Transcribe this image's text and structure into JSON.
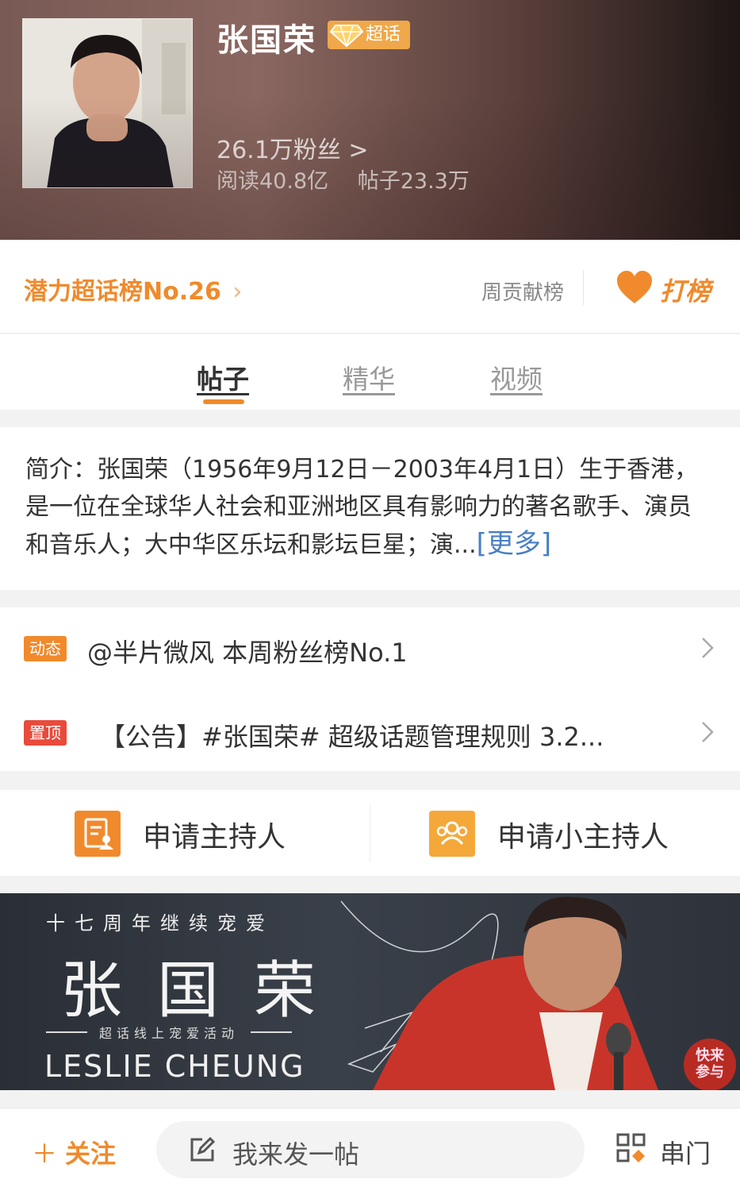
{
  "header": {
    "name": "张国荣",
    "badge": "超话",
    "fans": "26.1万粉丝 >",
    "reads": "阅读40.8亿",
    "posts": "帖子23.3万"
  },
  "rank": {
    "label": "潜力超话榜No.26",
    "contrib_label": "周贡献榜",
    "vote_label": "打榜"
  },
  "tabs": [
    {
      "label": "帖子",
      "active": true
    },
    {
      "label": "精华",
      "active": false
    },
    {
      "label": "视频",
      "active": false
    }
  ],
  "intro": {
    "text": "简介：张国荣（1956年9月12日－2003年4月1日）生于香港，是一位在全球华人社会和亚洲地区具有影响力的著名歌手、演员和音乐人；大中华区乐坛和影坛巨星；演...",
    "more": "[更多]"
  },
  "notices": [
    {
      "tag": "动态",
      "tag_color": "#f08a2c",
      "text": "@半片微风 本周粉丝榜No.1"
    },
    {
      "tag": "置顶",
      "tag_color": "#e84b3c",
      "text": "【公告】#张国荣# 超级话题管理规则 3.2..."
    }
  ],
  "hosts": [
    {
      "label": "申请主持人",
      "icon": "document-person-icon",
      "color": "#f08a2c"
    },
    {
      "label": "申请小主持人",
      "icon": "group-icon",
      "color": "#f4a83a"
    }
  ],
  "banner": {
    "subtitle": "十七周年继续宠爱",
    "title": "张国荣",
    "activity": "超话线上宠爱活动",
    "english": "LESLIE CHEUNG",
    "join_line1": "快来",
    "join_line2": "参与"
  },
  "bottom": {
    "follow": "关注",
    "post_placeholder": "我来发一帖",
    "chuanmen": "串门"
  },
  "colors": {
    "accent": "#f08a2c",
    "link": "#4a7fc4",
    "pin": "#e84b3c"
  }
}
